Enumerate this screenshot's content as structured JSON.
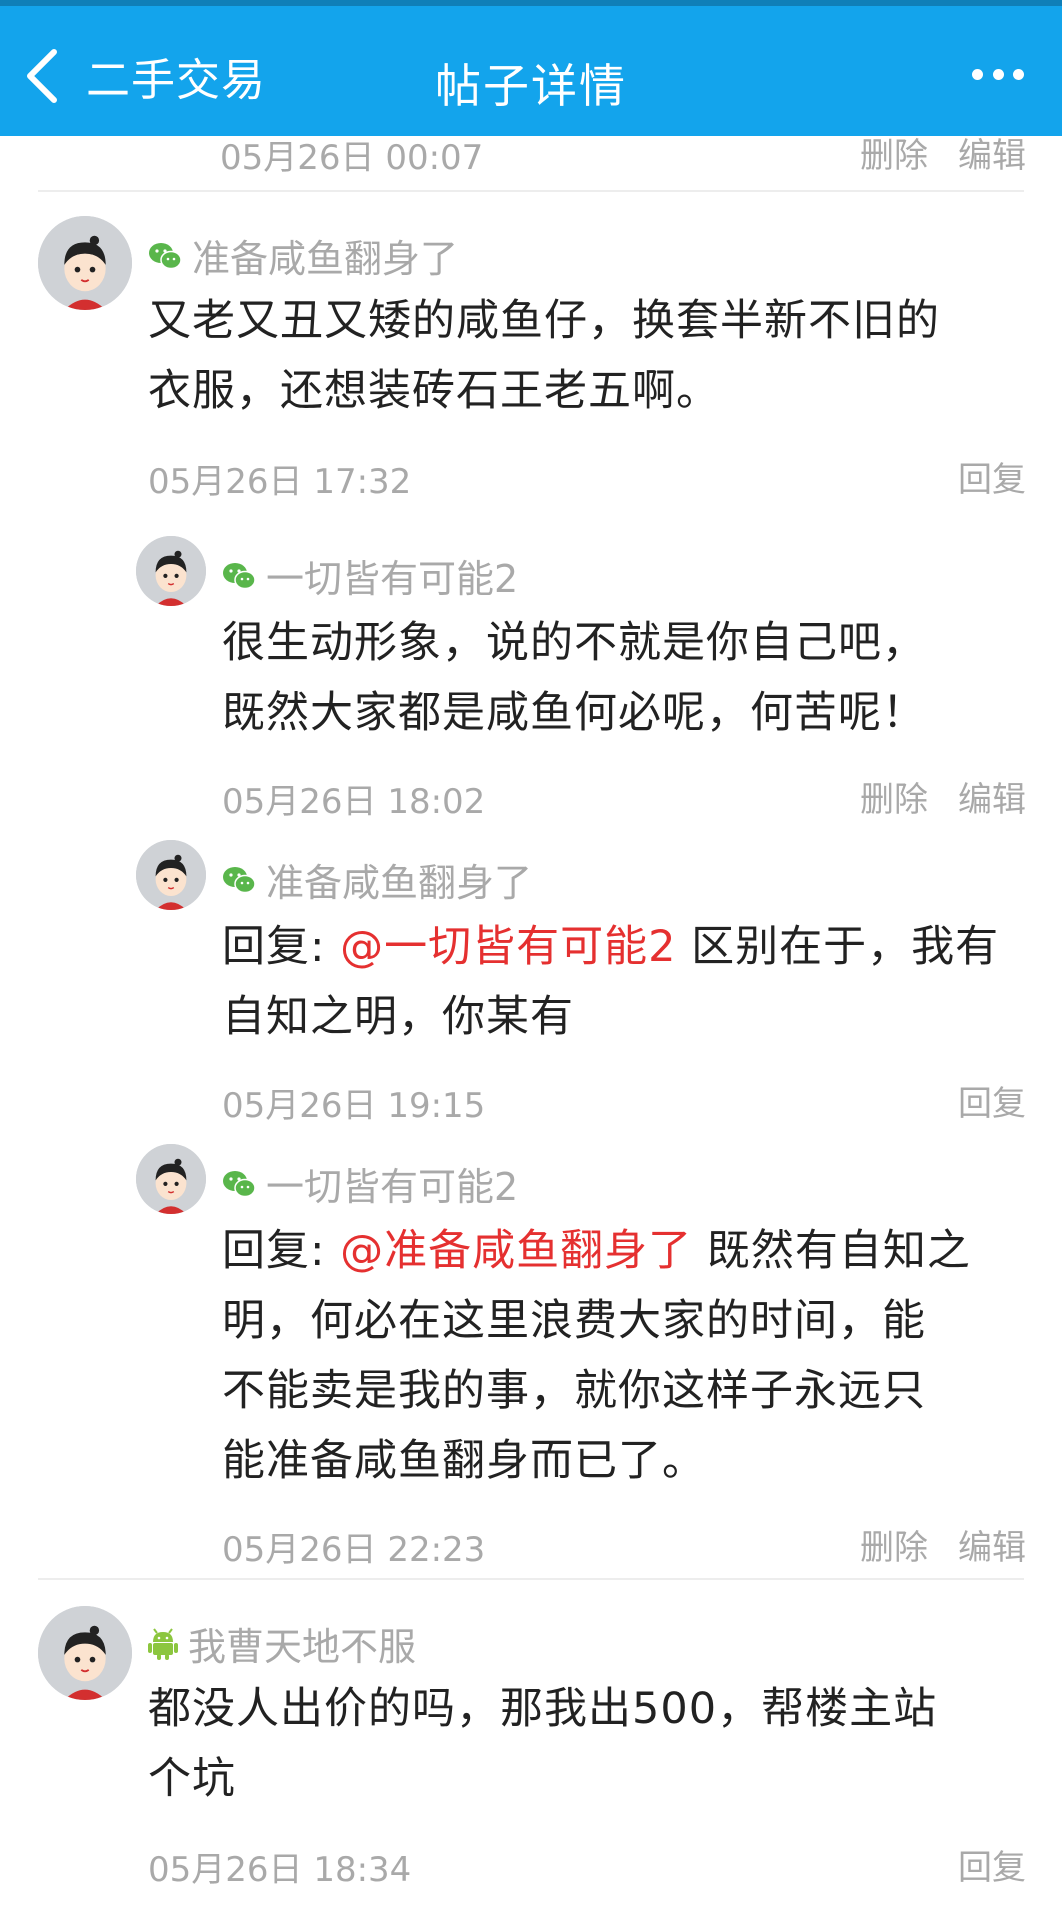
{
  "header": {
    "back_label": "二手交易",
    "title": "帖子详情"
  },
  "top_meta": {
    "time": "05月26日 00:07",
    "delete": "删除",
    "edit": "编辑"
  },
  "comment1": {
    "user": "准备咸鱼翻身了",
    "platform_icon": "wechat-icon",
    "lines": [
      "又老又丑又矮的咸鱼仔，换套半新不旧的",
      "衣服，还想装砖石王老五啊。"
    ],
    "time": "05月26日 17:32",
    "reply": "回复",
    "replies": [
      {
        "user": "一切皆有可能2",
        "platform_icon": "wechat-icon",
        "lines": [
          "很生动形象，说的不就是你自己吧，",
          "既然大家都是咸鱼何必呢，何苦呢！"
        ],
        "time": "05月26日 18:02",
        "delete": "删除",
        "edit": "编辑"
      },
      {
        "user": "准备咸鱼翻身了",
        "platform_icon": "wechat-icon",
        "prefix": "回复: ",
        "mention": "@一切皆有可能2",
        "line1_rest": " 区别在于，我有",
        "line2": "自知之明，你某有",
        "time": "05月26日 19:15",
        "reply": "回复"
      },
      {
        "user": "一切皆有可能2",
        "platform_icon": "wechat-icon",
        "prefix": "回复: ",
        "mention": "@准备咸鱼翻身了",
        "line1_rest": " 既然有自知之",
        "line2": "明，何必在这里浪费大家的时间，能",
        "line3": "不能卖是我的事，就你这样子永远只",
        "line4": "能准备咸鱼翻身而已了。",
        "time": "05月26日 22:23",
        "delete": "删除",
        "edit": "编辑"
      }
    ]
  },
  "comment2": {
    "user": "我曹天地不服",
    "platform_icon": "android-icon",
    "lines": [
      "都没人出价的吗，那我出500，帮楼主站",
      "个坑"
    ],
    "time": "05月26日 18:34",
    "reply": "回复"
  },
  "colors": {
    "header_bg": "#13a4ec",
    "mention": "#e53030",
    "wechat_green": "#59b64b",
    "android_green": "#8cc63f"
  }
}
